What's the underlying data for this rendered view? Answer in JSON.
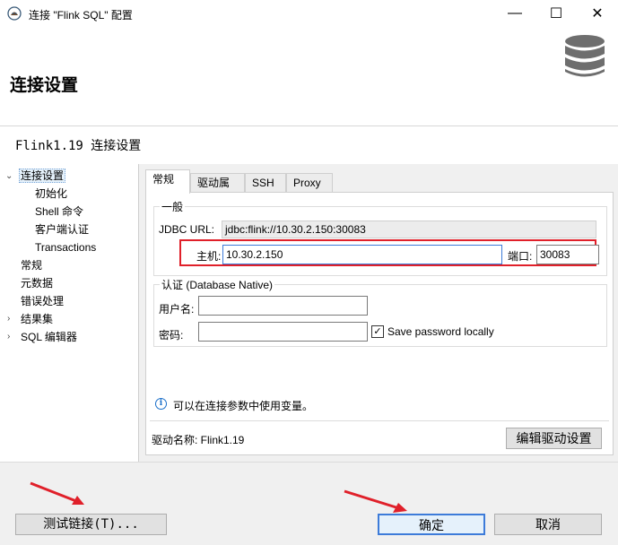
{
  "window": {
    "title": "连接 \"Flink SQL\" 配置",
    "minimize": "—",
    "maximize": "☐",
    "close": "✕"
  },
  "header": {
    "heading": "连接设置",
    "subtitle": "Flink1.19 连接设置"
  },
  "nav": [
    {
      "label": "连接设置",
      "selected": true,
      "expanded": true
    },
    {
      "label": "初始化"
    },
    {
      "label": "Shell 命令"
    },
    {
      "label": "客户端认证"
    },
    {
      "label": "Transactions"
    },
    {
      "label": "常规"
    },
    {
      "label": "元数据"
    },
    {
      "label": "错误处理"
    },
    {
      "label": "结果集",
      "collapsed": true
    },
    {
      "label": "SQL 编辑器",
      "collapsed": true
    }
  ],
  "tabs": [
    {
      "label": "常规",
      "active": true
    },
    {
      "label": "驱动属性"
    },
    {
      "label": "SSH"
    },
    {
      "label": "Proxy"
    }
  ],
  "general": {
    "legend": "一般",
    "jdbc_label": "JDBC URL:",
    "jdbc_value": "jdbc:flink://10.30.2.150:30083",
    "host_label": "主机:",
    "host_value": "10.30.2.150",
    "port_label": "端口:",
    "port_value": "30083"
  },
  "auth": {
    "legend": "认证 (Database Native)",
    "user_label": "用户名:",
    "user_value": "",
    "password_label": "密码:",
    "password_value": "",
    "save_password_label": "Save password locally",
    "save_password_checked": true
  },
  "info": {
    "text": "可以在连接参数中使用变量。"
  },
  "driver": {
    "text": "驱动名称:  Flink1.19",
    "edit_button": "编辑驱动设置"
  },
  "footer": {
    "test_button": "测试链接(T)...",
    "ok_button": "确定",
    "cancel_button": "取消"
  },
  "colors": {
    "highlight_border": "#e0202a",
    "arrow": "#e0202a",
    "focus_blue": "#3d7bd9"
  }
}
